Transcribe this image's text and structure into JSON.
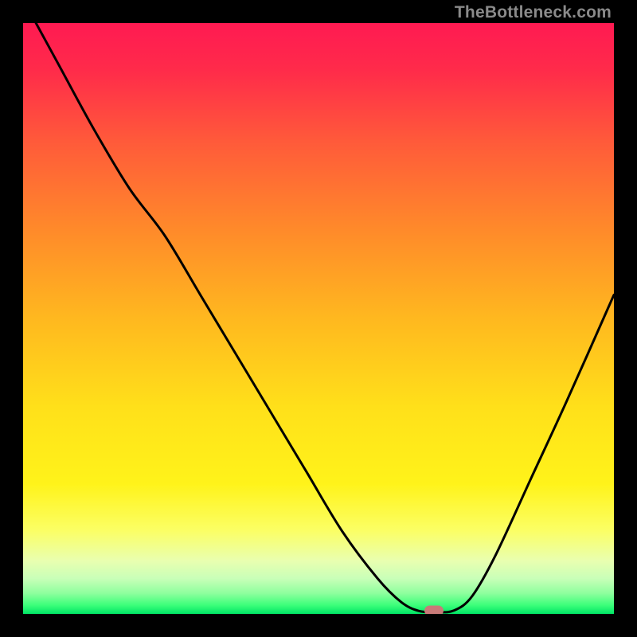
{
  "watermark": "TheBottleneck.com",
  "colors": {
    "frame_bg": "#000000",
    "curve": "#000000",
    "marker": "#c97a78",
    "gradient_stops": [
      {
        "offset": 0.0,
        "color": "#ff1a52"
      },
      {
        "offset": 0.08,
        "color": "#ff2b4a"
      },
      {
        "offset": 0.2,
        "color": "#ff5a3a"
      },
      {
        "offset": 0.35,
        "color": "#ff8a2a"
      },
      {
        "offset": 0.5,
        "color": "#ffb81f"
      },
      {
        "offset": 0.65,
        "color": "#ffe01a"
      },
      {
        "offset": 0.78,
        "color": "#fff31a"
      },
      {
        "offset": 0.86,
        "color": "#fbff66"
      },
      {
        "offset": 0.91,
        "color": "#e9ffb0"
      },
      {
        "offset": 0.94,
        "color": "#c9ffb8"
      },
      {
        "offset": 0.965,
        "color": "#8eff9e"
      },
      {
        "offset": 0.985,
        "color": "#3dff7a"
      },
      {
        "offset": 1.0,
        "color": "#00e565"
      }
    ]
  },
  "chart_data": {
    "type": "line",
    "title": "",
    "xlabel": "",
    "ylabel": "",
    "x_range": [
      0,
      100
    ],
    "y_range": [
      0,
      100
    ],
    "series": [
      {
        "name": "bottleneck_curve",
        "x": [
          0,
          6,
          12,
          18,
          24,
          30,
          36,
          42,
          48,
          54,
          60,
          64,
          67,
          70,
          73,
          76,
          80,
          86,
          92,
          100
        ],
        "y": [
          104,
          93,
          82,
          72,
          64,
          54,
          44,
          34,
          24,
          14,
          6,
          2,
          0.5,
          0.3,
          0.6,
          3,
          10,
          23,
          36,
          54
        ]
      }
    ],
    "marker": {
      "x": 69.5,
      "y": 0.6
    },
    "note": "Values are read off the rendered figure; y expressed as percent of plot height (0 = bottom, 100 = top). The curve starts above the visible top edge on the left."
  }
}
